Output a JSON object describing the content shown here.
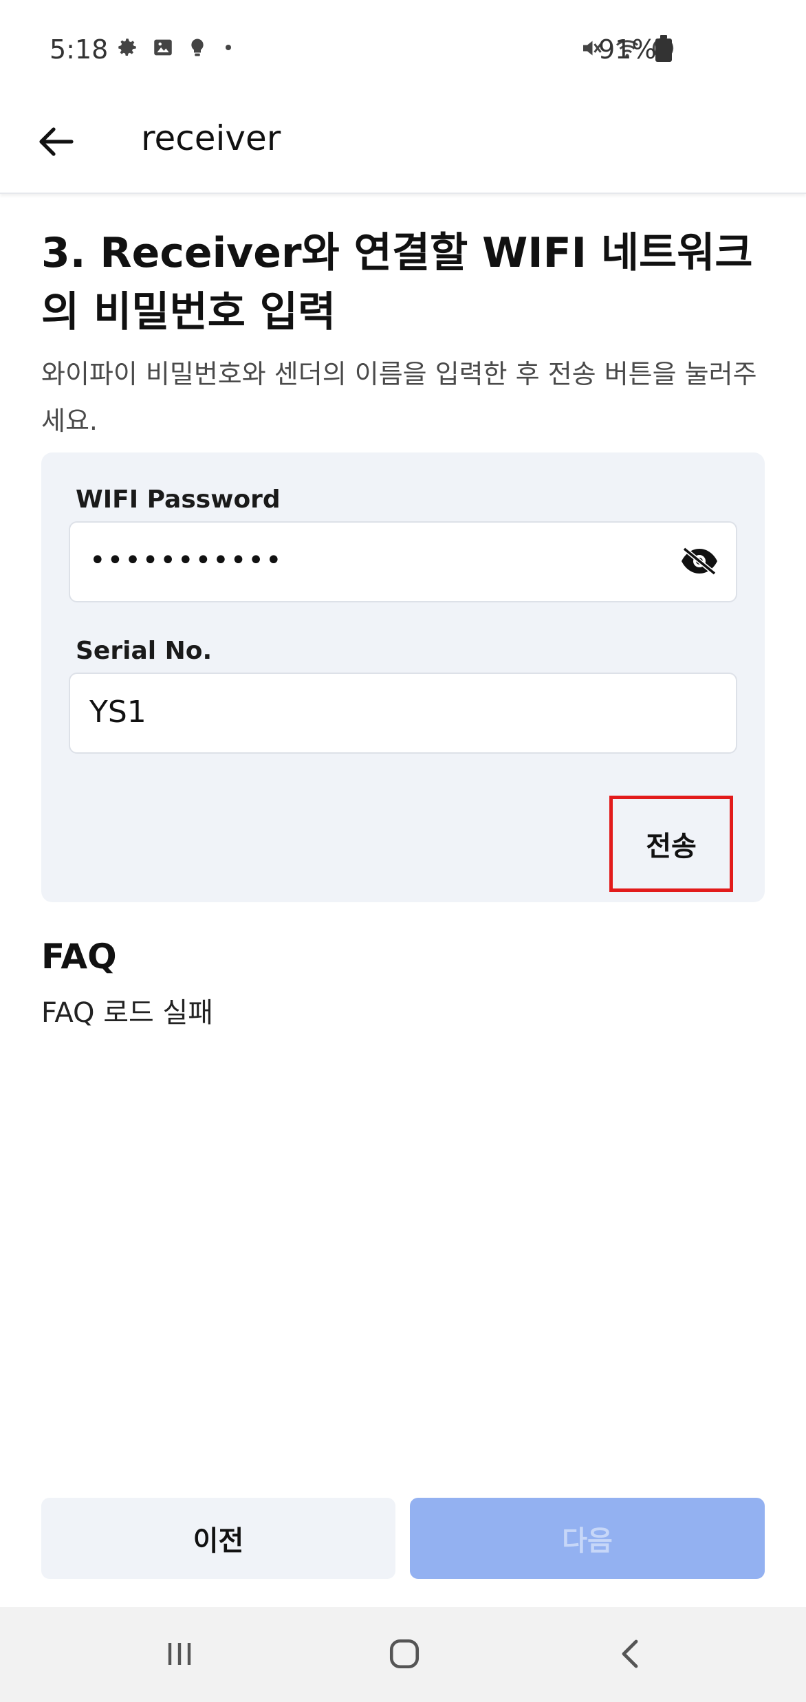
{
  "status_bar": {
    "time": "5:18",
    "battery": "91%",
    "left_icons": [
      "gear-icon",
      "image-icon",
      "bulb-icon",
      "dot-icon"
    ],
    "right_icons": [
      "mute-icon",
      "wifi-icon",
      "blocked-icon",
      "battery-icon"
    ]
  },
  "app_bar": {
    "title": "receiver"
  },
  "step": {
    "title": "3. Receiver와 연결할 WIFI 네트워크의 비밀번호 입력",
    "description": "와이파이 비밀번호와 센더의 이름을 입력한 후 전송 버튼을 눌러주세요."
  },
  "form": {
    "password_label": "WIFI Password",
    "password_value": "•••••••••••",
    "serial_label": "Serial No.",
    "serial_value": "YS1",
    "send_label": "전송"
  },
  "faq": {
    "title": "FAQ",
    "status": "FAQ 로드 실패"
  },
  "footer": {
    "prev_label": "이전",
    "next_label": "다음"
  },
  "colors": {
    "card_bg": "#f0f3f8",
    "next_disabled_bg": "#93b1f1",
    "highlight_border": "#e21b1b"
  }
}
